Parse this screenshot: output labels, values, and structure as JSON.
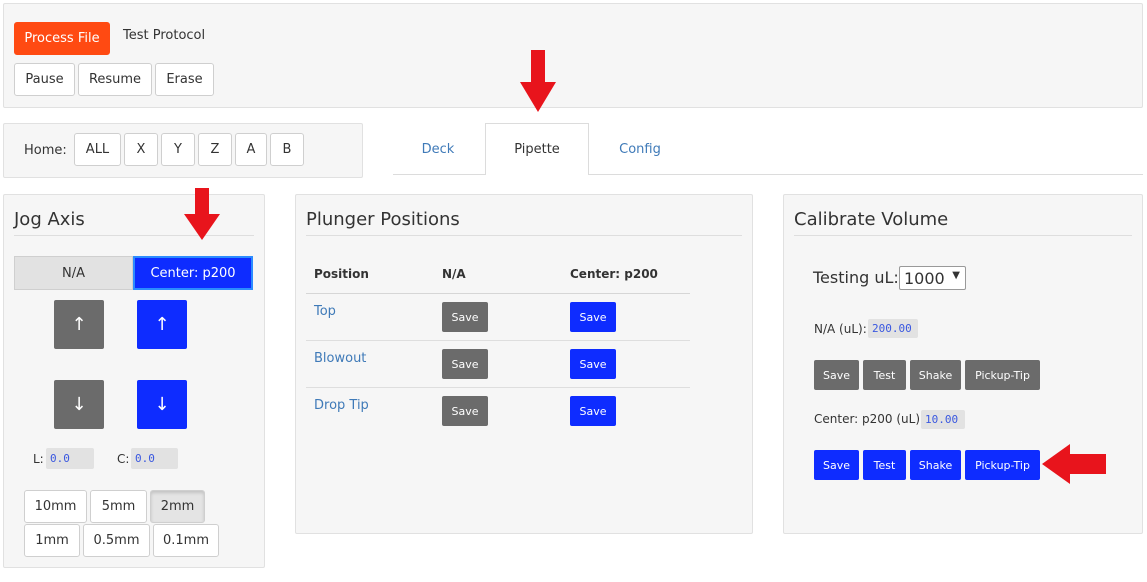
{
  "top": {
    "process_label": "Process File",
    "protocol_name": "Test Protocol",
    "pause_label": "Pause",
    "resume_label": "Resume",
    "erase_label": "Erase"
  },
  "home": {
    "label": "Home:",
    "buttons": [
      "ALL",
      "X",
      "Y",
      "Z",
      "A",
      "B"
    ]
  },
  "tabs": [
    "Deck",
    "Pipette",
    "Config"
  ],
  "active_tab": "Pipette",
  "jog": {
    "title": "Jog Axis",
    "axis_left": "N/A",
    "axis_right": "Center: p200",
    "up_glyph": "↑",
    "down_glyph": "↓",
    "left_label": "L:",
    "left_value": "0.0",
    "center_label": "C:",
    "center_value": "0.0",
    "steps_row1": [
      "10mm",
      "5mm",
      "2mm"
    ],
    "steps_row2": [
      "1mm",
      "0.5mm",
      "0.1mm"
    ],
    "selected_step": "2mm"
  },
  "plunger": {
    "title": "Plunger Positions",
    "columns": [
      "Position",
      "N/A",
      "Center: p200"
    ],
    "rows": [
      "Top",
      "Blowout",
      "Drop Tip"
    ],
    "save_label": "Save"
  },
  "calibrate": {
    "title": "Calibrate Volume",
    "testing_label": "Testing uL:",
    "testing_value": "1000",
    "left_label": "N/A (uL):",
    "left_value": "200.00",
    "right_label": "Center: p200 (uL):",
    "right_value": "10.00",
    "actions": [
      "Save",
      "Test",
      "Shake",
      "Pickup-Tip"
    ]
  },
  "colors": {
    "orange": "#ff4a12",
    "blue": "#0e2cff",
    "grey": "#6b6b6b",
    "arrow": "#e8141c",
    "link": "#3f7ab8"
  },
  "icons": {
    "annotation": "red-arrow-icon",
    "dropdown": "caret-down-icon"
  }
}
